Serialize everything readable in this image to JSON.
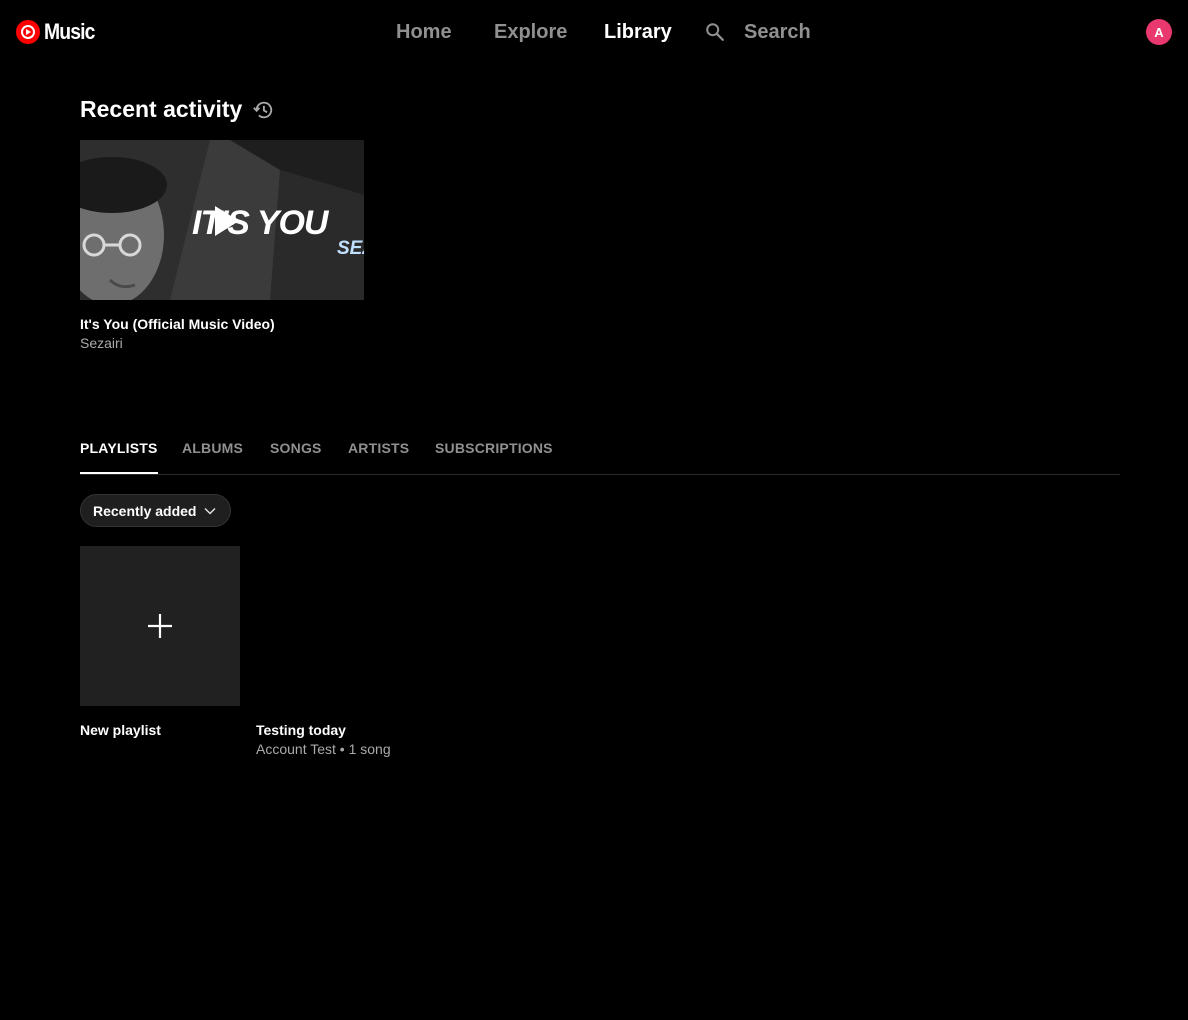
{
  "header": {
    "logo_text": "Music",
    "nav": [
      "Home",
      "Explore",
      "Library"
    ],
    "active_nav": "Library",
    "search_label": "Search",
    "avatar_letter": "A"
  },
  "recent": {
    "heading": "Recent activity",
    "item": {
      "title": "It's You (Official Music Video)",
      "subtitle": "Sezairi",
      "thumb_caption": "IT'S YOU",
      "thumb_tag": "SEZ"
    }
  },
  "library": {
    "tabs": [
      "PLAYLISTS",
      "ALBUMS",
      "SONGS",
      "ARTISTS",
      "SUBSCRIPTIONS"
    ],
    "active_tab": "PLAYLISTS",
    "sort_label": "Recently added",
    "items": [
      {
        "title": "New playlist",
        "subtitle": ""
      },
      {
        "title": "Testing today",
        "subtitle": "Account Test • 1 song"
      }
    ]
  },
  "colors": {
    "brand_red": "#ff0000",
    "avatar_bg": "#e8386d",
    "inactive_text": "#909090",
    "secondary_text": "#aaaaaa"
  }
}
